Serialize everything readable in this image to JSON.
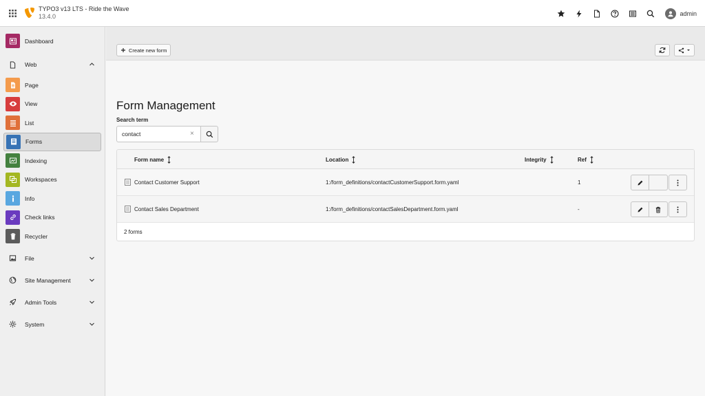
{
  "topbar": {
    "title": "TYPO3 v13 LTS - Ride the Wave",
    "version": "13.4.0",
    "user": "admin",
    "icons": [
      "star-icon",
      "bolt-icon",
      "document-icon",
      "help-icon",
      "list-icon",
      "search-icon"
    ]
  },
  "sidebar": {
    "dashboard": "Dashboard",
    "web": "Web",
    "modules": [
      {
        "label": "Page",
        "color": "#f49b4c",
        "icon": "page-icon"
      },
      {
        "label": "View",
        "color": "#d73d3d",
        "icon": "eye-icon"
      },
      {
        "label": "List",
        "color": "#e0703a",
        "icon": "list-icon"
      },
      {
        "label": "Forms",
        "color": "#3873b5",
        "icon": "form-icon"
      },
      {
        "label": "Indexing",
        "color": "#44813f",
        "icon": "indexing-icon"
      },
      {
        "label": "Workspaces",
        "color": "#a4b722",
        "icon": "workspaces-icon"
      },
      {
        "label": "Info",
        "color": "#59a7e0",
        "icon": "info-icon"
      },
      {
        "label": "Check links",
        "color": "#6a3bbf",
        "icon": "link-icon"
      },
      {
        "label": "Recycler",
        "color": "#5b5b5b",
        "icon": "trash-icon"
      }
    ],
    "groups": [
      "File",
      "Site Management",
      "Admin Tools",
      "System"
    ],
    "accent_dashboard": "#a52a64"
  },
  "toolbar": {
    "create_label": "Create new form"
  },
  "main": {
    "title": "Form Management",
    "search_label": "Search term",
    "search_value": "contact",
    "search_clear": "×"
  },
  "table": {
    "headers": {
      "name": "Form name",
      "location": "Location",
      "integrity": "Integrity",
      "ref": "Ref"
    },
    "rows": [
      {
        "name": "Contact Customer Support",
        "location": "1:/form_definitions/contactCustomerSupport.form.yaml",
        "ref": "1"
      },
      {
        "name": "Contact Sales Department",
        "location": "1:/form_definitions/contactSalesDepartment.form.yaml",
        "ref": "-"
      }
    ],
    "footer": "2 forms"
  }
}
